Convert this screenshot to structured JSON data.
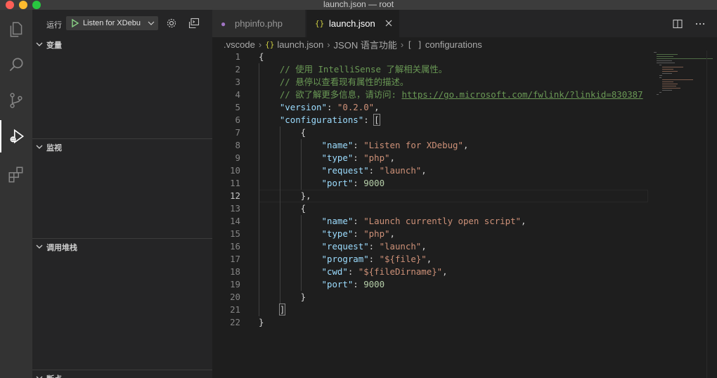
{
  "window": {
    "title": "launch.json — root"
  },
  "sidebar": {
    "run_label": "运行",
    "config_select": "Listen for XDebu",
    "sections": [
      "变量",
      "监视",
      "调用堆栈",
      "断点"
    ]
  },
  "tabs": [
    {
      "label": "phpinfo.php",
      "icon": "php-elephant-icon"
    },
    {
      "label": "launch.json",
      "icon": "json-braces-icon",
      "active": true
    }
  ],
  "breadcrumb": {
    "folder": ".vscode",
    "file": "launch.json",
    "language": "JSON 语言功能",
    "node": "configurations"
  },
  "editor": {
    "current_line": 12,
    "lines": [
      [
        [
          "p",
          "{"
        ]
      ],
      [
        [
          "p",
          "    "
        ],
        [
          "c",
          "// 使用 IntelliSense 了解相关属性。"
        ]
      ],
      [
        [
          "p",
          "    "
        ],
        [
          "c",
          "// 悬停以查看现有属性的描述。"
        ]
      ],
      [
        [
          "p",
          "    "
        ],
        [
          "c",
          "// 欲了解更多信息，请访问: "
        ],
        [
          "u",
          "https://go.microsoft.com/fwlink/?linkid=830387"
        ]
      ],
      [
        [
          "p",
          "    "
        ],
        [
          "k",
          "\"version\""
        ],
        [
          "p",
          ": "
        ],
        [
          "s",
          "\"0.2.0\""
        ],
        [
          "p",
          ","
        ]
      ],
      [
        [
          "p",
          "    "
        ],
        [
          "k",
          "\"configurations\""
        ],
        [
          "p",
          ": "
        ],
        [
          "b",
          "["
        ]
      ],
      [
        [
          "p",
          "        {"
        ]
      ],
      [
        [
          "p",
          "            "
        ],
        [
          "k",
          "\"name\""
        ],
        [
          "p",
          ": "
        ],
        [
          "s",
          "\"Listen for XDebug\""
        ],
        [
          "p",
          ","
        ]
      ],
      [
        [
          "p",
          "            "
        ],
        [
          "k",
          "\"type\""
        ],
        [
          "p",
          ": "
        ],
        [
          "s",
          "\"php\""
        ],
        [
          "p",
          ","
        ]
      ],
      [
        [
          "p",
          "            "
        ],
        [
          "k",
          "\"request\""
        ],
        [
          "p",
          ": "
        ],
        [
          "s",
          "\"launch\""
        ],
        [
          "p",
          ","
        ]
      ],
      [
        [
          "p",
          "            "
        ],
        [
          "k",
          "\"port\""
        ],
        [
          "p",
          ": "
        ],
        [
          "n",
          "9000"
        ]
      ],
      [
        [
          "p",
          "        },"
        ]
      ],
      [
        [
          "p",
          "        {"
        ]
      ],
      [
        [
          "p",
          "            "
        ],
        [
          "k",
          "\"name\""
        ],
        [
          "p",
          ": "
        ],
        [
          "s",
          "\"Launch currently open script\""
        ],
        [
          "p",
          ","
        ]
      ],
      [
        [
          "p",
          "            "
        ],
        [
          "k",
          "\"type\""
        ],
        [
          "p",
          ": "
        ],
        [
          "s",
          "\"php\""
        ],
        [
          "p",
          ","
        ]
      ],
      [
        [
          "p",
          "            "
        ],
        [
          "k",
          "\"request\""
        ],
        [
          "p",
          ": "
        ],
        [
          "s",
          "\"launch\""
        ],
        [
          "p",
          ","
        ]
      ],
      [
        [
          "p",
          "            "
        ],
        [
          "k",
          "\"program\""
        ],
        [
          "p",
          ": "
        ],
        [
          "s",
          "\"${file}\""
        ],
        [
          "p",
          ","
        ]
      ],
      [
        [
          "p",
          "            "
        ],
        [
          "k",
          "\"cwd\""
        ],
        [
          "p",
          ": "
        ],
        [
          "s",
          "\"${fileDirname}\""
        ],
        [
          "p",
          ","
        ]
      ],
      [
        [
          "p",
          "            "
        ],
        [
          "k",
          "\"port\""
        ],
        [
          "p",
          ": "
        ],
        [
          "n",
          "9000"
        ]
      ],
      [
        [
          "p",
          "        }"
        ]
      ],
      [
        [
          "p",
          "    "
        ],
        [
          "b",
          "]"
        ]
      ],
      [
        [
          "p",
          "}"
        ]
      ]
    ]
  },
  "colors": {
    "activity_bar": "#333333",
    "sidebar": "#252526",
    "editor": "#1e1e1e",
    "json_key": "#9cdcfe",
    "string": "#ce9178",
    "number": "#b5cea8",
    "comment": "#6a9955"
  }
}
